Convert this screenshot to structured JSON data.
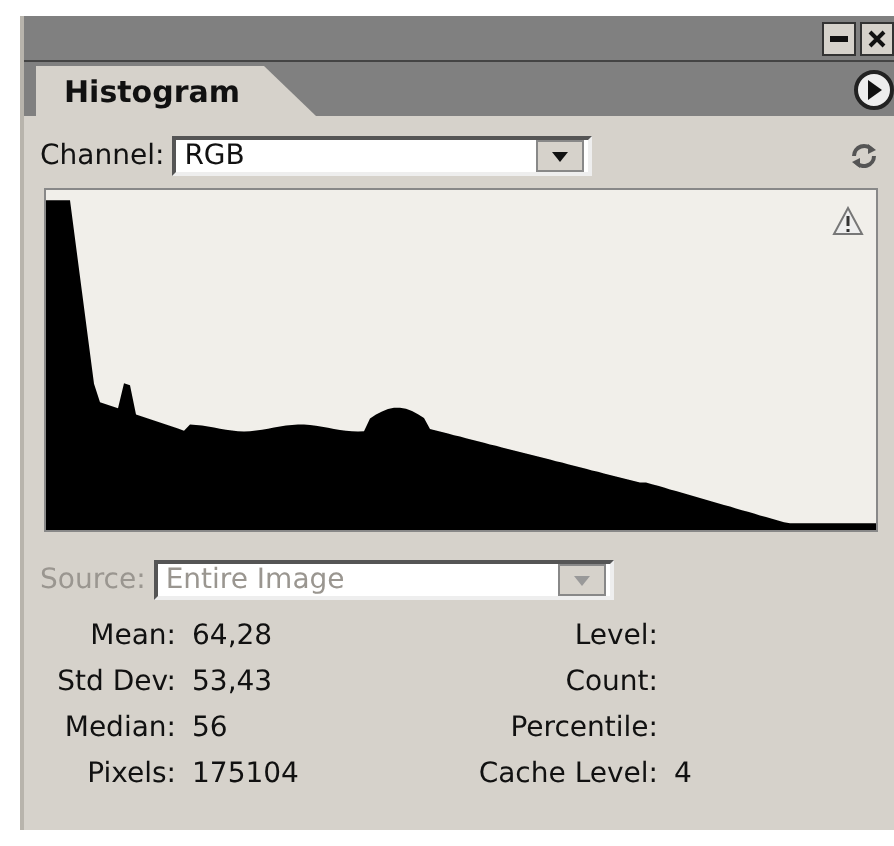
{
  "panel": {
    "tab": {
      "label": "Histogram",
      "selected": true
    }
  },
  "channel": {
    "label": "Channel:",
    "value": "RGB"
  },
  "source": {
    "label": "Source:",
    "value": "Entire Image",
    "disabled": true
  },
  "stats_left": [
    {
      "label": "Mean:",
      "value": "64,28"
    },
    {
      "label": "Std Dev:",
      "value": "53,43"
    },
    {
      "label": "Median:",
      "value": "56"
    },
    {
      "label": "Pixels:",
      "value": "175104"
    }
  ],
  "stats_right": [
    {
      "label": "Level:"
    },
    {
      "label": "Count:"
    },
    {
      "label": "Percentile:"
    },
    {
      "label": "Cache Level:",
      "value": "4"
    }
  ]
}
